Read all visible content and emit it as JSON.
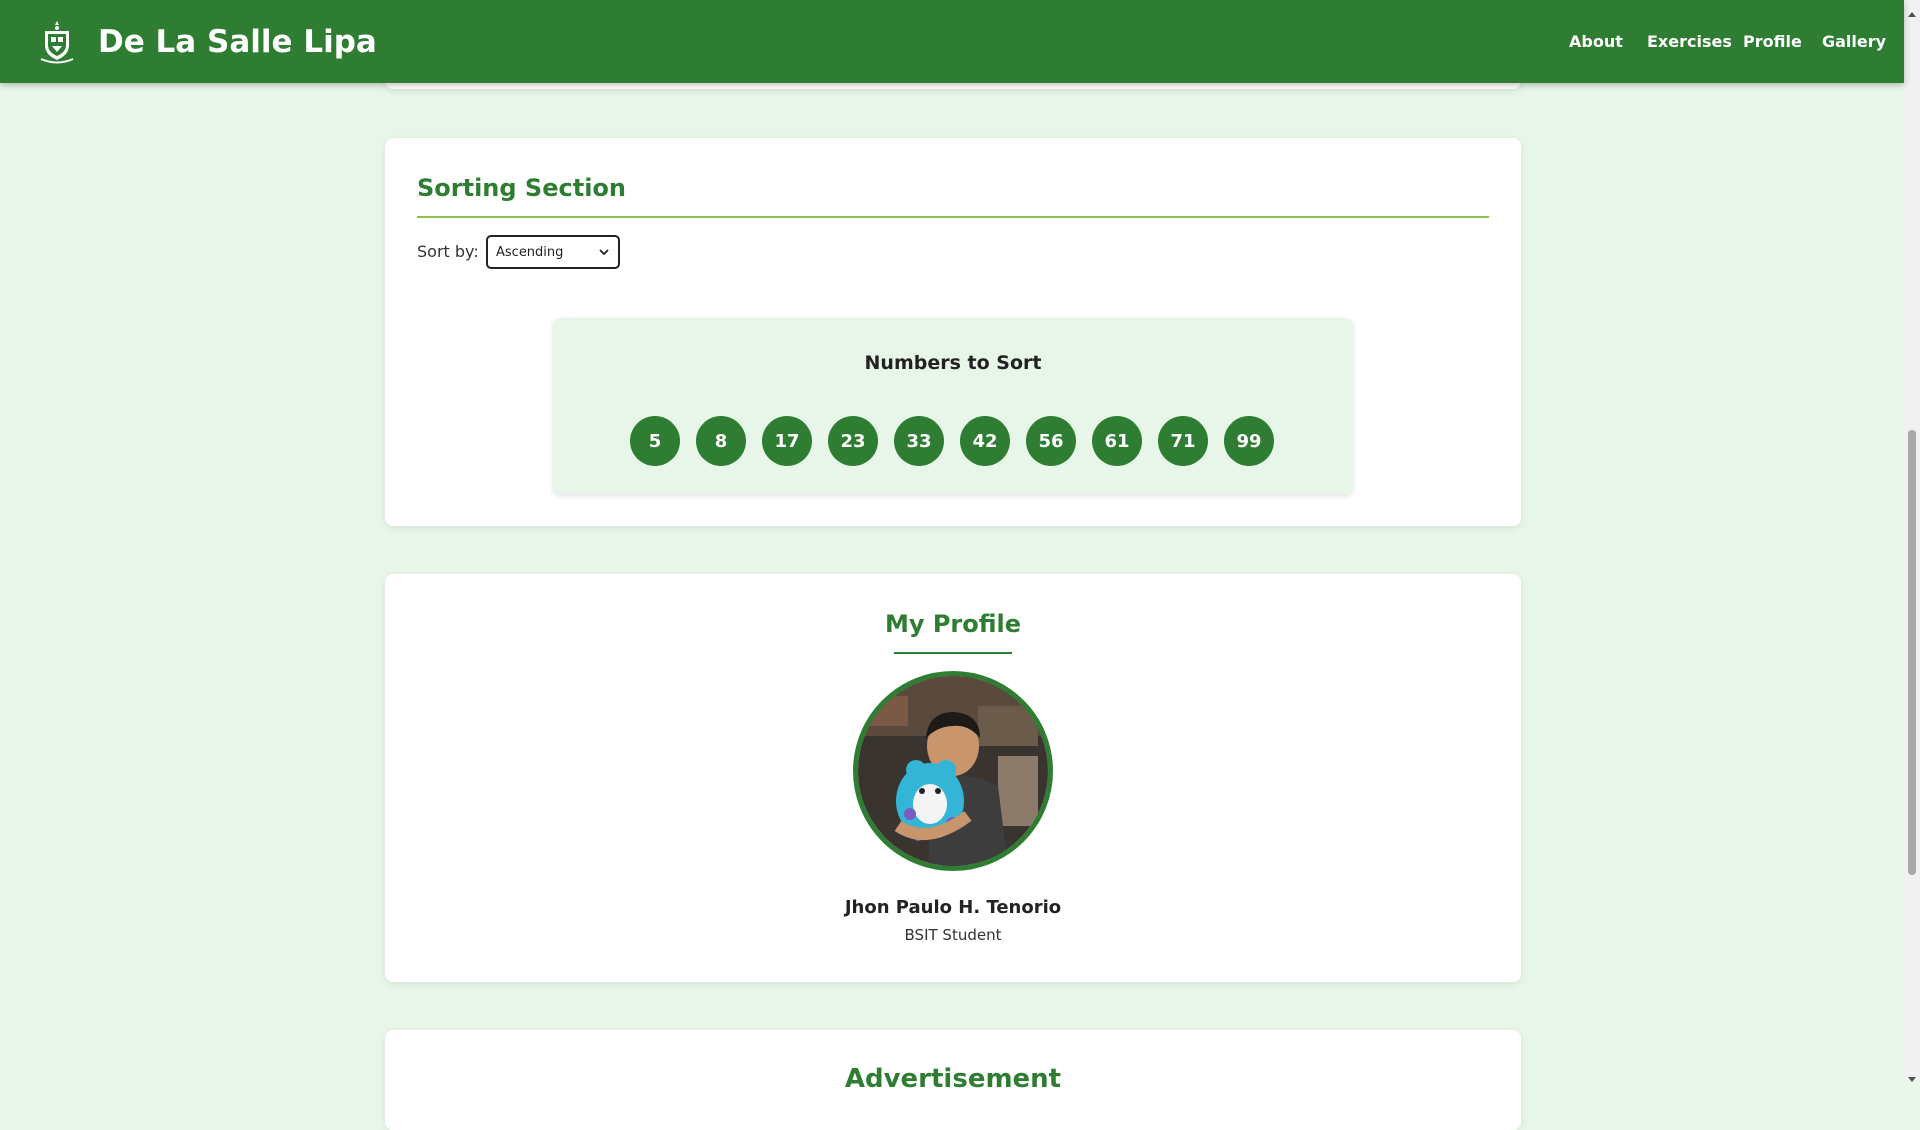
{
  "nav": {
    "brand": "De La Salle Lipa",
    "links": [
      "About",
      "Exercises",
      "Profile",
      "Gallery"
    ]
  },
  "sorting": {
    "title": "Sorting Section",
    "sort_label": "Sort by:",
    "sort_selected": "Ascending",
    "numbers_title": "Numbers to Sort",
    "numbers": [
      "5",
      "8",
      "17",
      "23",
      "33",
      "42",
      "56",
      "61",
      "71",
      "99"
    ]
  },
  "profile": {
    "title": "My Profile",
    "name": "Jhon Paulo H. Tenorio",
    "role": "BSIT Student"
  },
  "advertisement": {
    "title": "Advertisement"
  },
  "colors": {
    "brand_green": "#2e7d32",
    "page_background": "#e8f5e9",
    "accent_line": "#8bc34a"
  },
  "icons": {
    "logo": "school-crest-icon",
    "select_arrow": "chevron-down-icon"
  }
}
